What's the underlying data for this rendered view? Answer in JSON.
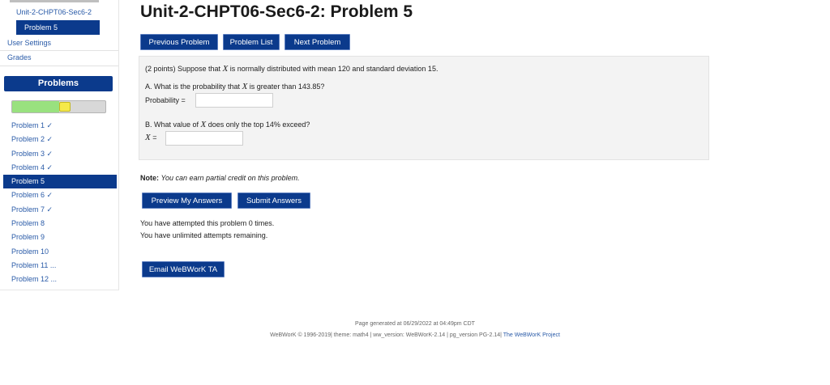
{
  "sidebar": {
    "set_link": "Unit-2-CHPT06-Sec6-2",
    "current_problem": "Problem 5",
    "user_settings": "User Settings",
    "grades": "Grades",
    "panel_title": "Problems",
    "progress": {
      "correct_fraction": 0.5,
      "incorrect_fraction": 0.0,
      "current_fraction": 0.125,
      "green_color": "#99e17f",
      "yellow_color": "#f5e94a"
    },
    "problems": [
      {
        "label": "Problem 1 ✓",
        "active": false
      },
      {
        "label": "Problem 2 ✓",
        "active": false
      },
      {
        "label": "Problem 3 ✓",
        "active": false
      },
      {
        "label": "Problem 4 ✓",
        "active": false
      },
      {
        "label": "Problem 5",
        "active": true
      },
      {
        "label": "Problem 6 ✓",
        "active": false
      },
      {
        "label": "Problem 7 ✓",
        "active": false
      },
      {
        "label": "Problem 8",
        "active": false
      },
      {
        "label": "Problem 9",
        "active": false
      },
      {
        "label": "Problem 10",
        "active": false
      },
      {
        "label": "Problem 11 ...",
        "active": false
      },
      {
        "label": "Problem 12 ...",
        "active": false
      }
    ]
  },
  "main": {
    "title": "Unit-2-CHPT06-Sec6-2: Problem 5",
    "nav": {
      "previous": "Previous Problem",
      "list": "Problem List",
      "next": "Next Problem"
    },
    "problem": {
      "intro_pre": "(2 points) Suppose that ",
      "var": "X",
      "intro_post": " is normally distributed with mean 120 and standard deviation 15.",
      "part_a_pre": "A. What is the probability that ",
      "part_a_post": " is greater than 143.85?",
      "prob_label": "Probability =",
      "part_b_pre": "B. What value of ",
      "part_b_post": " does only the top 14% exceed?",
      "x_label": "=",
      "answer_a_value": "",
      "answer_b_value": ""
    },
    "note_label": "Note:",
    "note_text": "You can earn partial credit on this problem.",
    "buttons": {
      "preview": "Preview My Answers",
      "submit": "Submit Answers",
      "email": "Email WeBWorK TA"
    },
    "attempts": "You have attempted this problem 0 times.",
    "remaining": "You have unlimited attempts remaining."
  },
  "footer": {
    "generated": "Page generated at 06/29/2022 at 04:49pm CDT",
    "line2_a": "WeBWorK © 1996-2019| theme: math4 | ww_version: WeBWorK-2.14 | pg_version PG-2.14|",
    "line2_link": "The WeBWorK Project"
  }
}
